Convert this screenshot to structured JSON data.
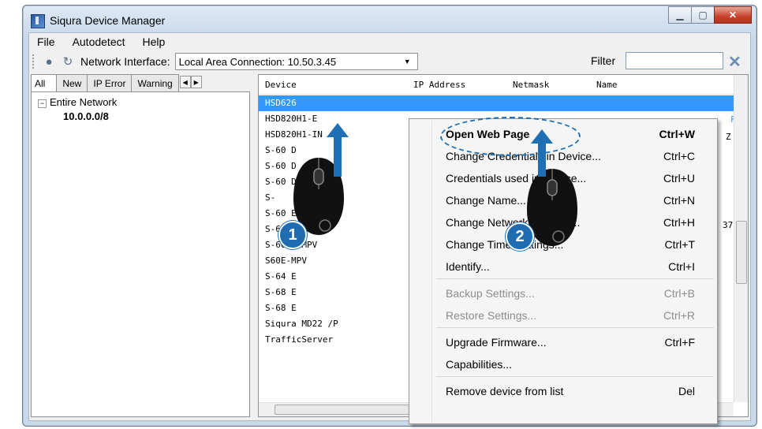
{
  "window": {
    "title": "Siqura Device Manager"
  },
  "menu": [
    "File",
    "Autodetect",
    "Help"
  ],
  "toolbar": {
    "network_label": "Network Interface:",
    "network_value": "Local Area Connection: 10.50.3.45",
    "filter_label": "Filter",
    "filter_value": ""
  },
  "tabs": [
    "All",
    "New",
    "IP Error",
    "Warning"
  ],
  "tree": {
    "root": "Entire Network",
    "child": "10.0.0.0/8"
  },
  "columns": [
    "Device",
    "IP Address",
    "Netmask",
    "Name"
  ],
  "devices": [
    "HSD626",
    "HSD820H1-E",
    "HSD820H1-IN",
    "S-60 D",
    "S-60 D",
    "S-60 D",
    "S-",
    "S-60 E-MPV",
    "S-60 E-MPV",
    "S-60 E-MPV",
    "S60E-MPV",
    "S-64 E",
    "S-68 E",
    "S-68 E",
    "Siqura MD22 /P",
    "TrafficServer"
  ],
  "right_edge_fragments": [
    "F",
    "Z",
    "37"
  ],
  "context_menu": [
    {
      "label": "Open Web Page",
      "key": "Ctrl+W",
      "bold": true
    },
    {
      "label": "Change Credentials in Device...",
      "key": "Ctrl+C"
    },
    {
      "label": "Credentials used in Device...",
      "key": "Ctrl+U"
    },
    {
      "label": "Change Name...",
      "key": "Ctrl+N"
    },
    {
      "label": "Change Network Settings...",
      "key": "Ctrl+H"
    },
    {
      "label": "Change Time Settings...",
      "key": "Ctrl+T"
    },
    {
      "label": "Identify...",
      "key": "Ctrl+I"
    },
    {
      "label": "Backup Settings...",
      "key": "Ctrl+B",
      "disabled": true
    },
    {
      "label": "Restore Settings...",
      "key": "Ctrl+R",
      "disabled": true
    },
    {
      "label": "Upgrade Firmware...",
      "key": "Ctrl+F"
    },
    {
      "label": "Capabilities...",
      "key": ""
    },
    {
      "label": "Remove device from list",
      "key": "Del"
    }
  ],
  "callouts": [
    "1",
    "2"
  ],
  "colors": {
    "accent": "#1e6fb3",
    "selection": "#3399ff"
  },
  "icons": [
    "app-icon",
    "network-icon",
    "refresh-icon",
    "clear-filter-icon",
    "mouse-icon"
  ]
}
